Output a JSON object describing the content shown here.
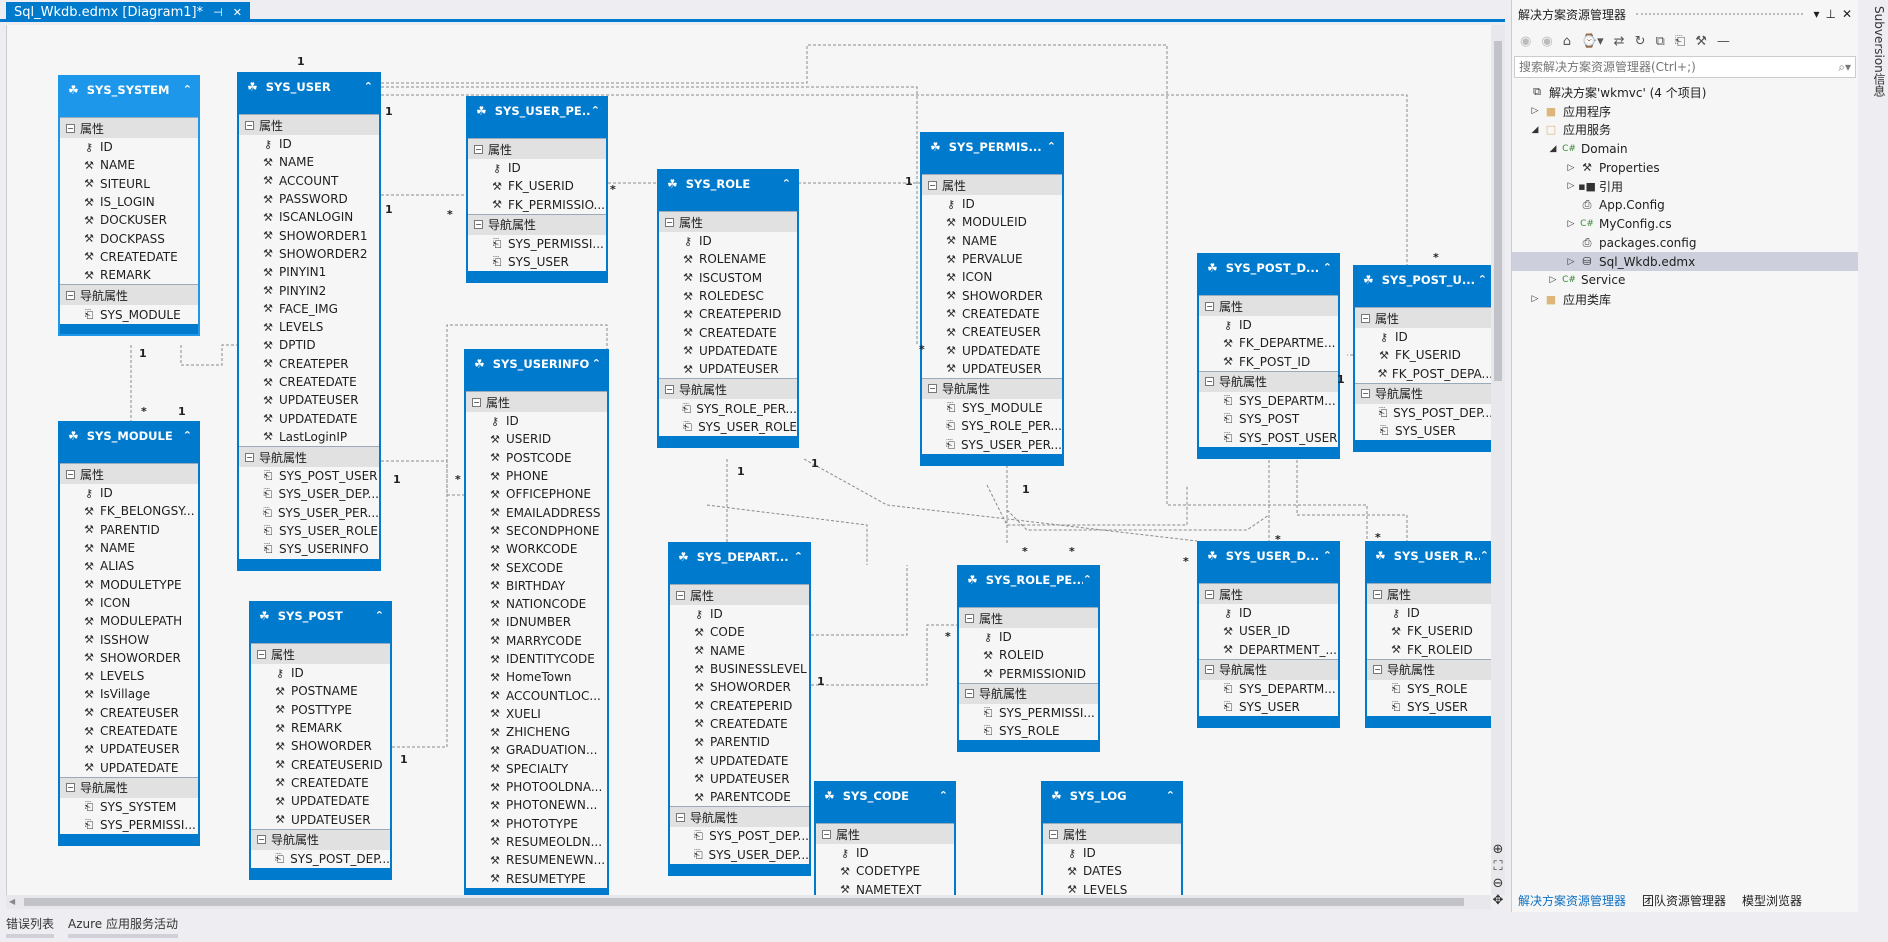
{
  "document_tab": {
    "title": "Sql_Wkdb.edmx [Diagram1]*",
    "pin_icon": "pin-icon",
    "close_icon": "close-icon"
  },
  "colors": {
    "entity_header": "#007acc",
    "entity_header_selected": "#1c97ea",
    "group_bg": "#e1e1e1",
    "accent": "#007acc"
  },
  "diagram": {
    "group_properties": "属性",
    "group_navigation": "导航属性",
    "multiplicity": {
      "one": "1",
      "many": "*"
    },
    "entities": [
      {
        "name": "SYS_SYSTEM",
        "selected": true,
        "properties": [
          "ID",
          "NAME",
          "SITEURL",
          "IS_LOGIN",
          "DOCKUSER",
          "DOCKPASS",
          "CREATEDATE",
          "REMARK"
        ],
        "navigation": [
          "SYS_MODULE"
        ]
      },
      {
        "name": "SYS_USER",
        "properties": [
          "ID",
          "NAME",
          "ACCOUNT",
          "PASSWORD",
          "ISCANLOGIN",
          "SHOWORDER1",
          "SHOWORDER2",
          "PINYIN1",
          "PINYIN2",
          "FACE_IMG",
          "LEVELS",
          "DPTID",
          "CREATEPER",
          "CREATEDATE",
          "UPDATEUSER",
          "UPDATEDATE",
          "LastLoginIP"
        ],
        "navigation": [
          "SYS_POST_USER",
          "SYS_USER_DEP...",
          "SYS_USER_PER...",
          "SYS_USER_ROLE",
          "SYS_USERINFO"
        ]
      },
      {
        "name": "SYS_USER_PE...",
        "properties": [
          "ID",
          "FK_USERID",
          "FK_PERMISSIO..."
        ],
        "navigation": [
          "SYS_PERMISSI...",
          "SYS_USER"
        ]
      },
      {
        "name": "SYS_ROLE",
        "properties": [
          "ID",
          "ROLENAME",
          "ISCUSTOM",
          "ROLEDESC",
          "CREATEPERID",
          "CREATEDATE",
          "UPDATEDATE",
          "UPDATEUSER"
        ],
        "navigation": [
          "SYS_ROLE_PER...",
          "SYS_USER_ROLE"
        ]
      },
      {
        "name": "SYS_PERMIS...",
        "properties": [
          "ID",
          "MODULEID",
          "NAME",
          "PERVALUE",
          "ICON",
          "SHOWORDER",
          "CREATEDATE",
          "CREATEUSER",
          "UPDATEDATE",
          "UPDATEUSER"
        ],
        "navigation": [
          "SYS_MODULE",
          "SYS_ROLE_PER...",
          "SYS_USER_PER..."
        ]
      },
      {
        "name": "SYS_USERINFO",
        "properties": [
          "ID",
          "USERID",
          "POSTCODE",
          "PHONE",
          "OFFICEPHONE",
          "EMAILADDRESS",
          "SECONDPHONE",
          "WORKCODE",
          "SEXCODE",
          "BIRTHDAY",
          "NATIONCODE",
          "IDNUMBER",
          "MARRYCODE",
          "IDENTITYCODE",
          "HomeTown",
          "ACCOUNTLOC...",
          "XUELI",
          "ZHICHENG",
          "GRADUATION...",
          "SPECIALTY",
          "PHOTOOLDNA...",
          "PHOTONEWN...",
          "PHOTOTYPE",
          "RESUMEOLDN...",
          "RESUMENEWN...",
          "RESUMETYPE"
        ],
        "navigation": []
      },
      {
        "name": "SYS_MODULE",
        "properties": [
          "ID",
          "FK_BELONGSY...",
          "PARENTID",
          "NAME",
          "ALIAS",
          "MODULETYPE",
          "ICON",
          "MODULEPATH",
          "ISSHOW",
          "SHOWORDER",
          "LEVELS",
          "IsVillage",
          "CREATEUSER",
          "CREATEDATE",
          "UPDATEUSER",
          "UPDATEDATE"
        ],
        "navigation": [
          "SYS_SYSTEM",
          "SYS_PERMISSI..."
        ]
      },
      {
        "name": "SYS_POST",
        "properties": [
          "ID",
          "POSTNAME",
          "POSTTYPE",
          "REMARK",
          "SHOWORDER",
          "CREATEUSERID",
          "CREATEDATE",
          "UPDATEDATE",
          "UPDATEUSER"
        ],
        "navigation": [
          "SYS_POST_DEP..."
        ]
      },
      {
        "name": "SYS_DEPART...",
        "properties": [
          "ID",
          "CODE",
          "NAME",
          "BUSINESSLEVEL",
          "SHOWORDER",
          "CREATEPERID",
          "CREATEDATE",
          "PARENTID",
          "UPDATEDATE",
          "UPDATEUSER",
          "PARENTCODE"
        ],
        "navigation": [
          "SYS_POST_DEP...",
          "SYS_USER_DEP..."
        ]
      },
      {
        "name": "SYS_ROLE_PE...",
        "properties": [
          "ID",
          "ROLEID",
          "PERMISSIONID"
        ],
        "navigation": [
          "SYS_PERMISSI...",
          "SYS_ROLE"
        ]
      },
      {
        "name": "SYS_CODE",
        "properties": [
          "ID",
          "CODETYPE",
          "NAMETEXT"
        ],
        "navigation": []
      },
      {
        "name": "SYS_LOG",
        "properties": [
          "ID",
          "DATES",
          "LEVELS"
        ],
        "navigation": []
      },
      {
        "name": "SYS_POST_D...",
        "properties": [
          "ID",
          "FK_DEPARTME...",
          "FK_POST_ID"
        ],
        "navigation": [
          "SYS_DEPARTM...",
          "SYS_POST",
          "SYS_POST_USER"
        ]
      },
      {
        "name": "SYS_POST_U...",
        "properties": [
          "ID",
          "FK_USERID",
          "FK_POST_DEPA..."
        ],
        "navigation": [
          "SYS_POST_DEP...",
          "SYS_USER"
        ]
      },
      {
        "name": "SYS_USER_D...",
        "properties": [
          "ID",
          "USER_ID",
          "DEPARTMENT_..."
        ],
        "navigation": [
          "SYS_DEPARTM...",
          "SYS_USER"
        ]
      },
      {
        "name": "SYS_USER_R...",
        "properties": [
          "ID",
          "FK_USERID",
          "FK_ROLEID"
        ],
        "navigation": [
          "SYS_ROLE",
          "SYS_USER"
        ]
      }
    ]
  },
  "bottom_tabs": [
    "错误列表",
    "Azure 应用服务活动"
  ],
  "solution_explorer": {
    "title": "解决方案资源管理器",
    "search_placeholder": "搜索解决方案资源管理器(Ctrl+;)",
    "tree": [
      {
        "label": "解决方案'wkmvc' (4 个项目)",
        "level": 0,
        "expander": "none",
        "icon": "solution-icon"
      },
      {
        "label": "应用程序",
        "level": 0,
        "expander": "collapsed",
        "icon": "folder-icon"
      },
      {
        "label": "应用服务",
        "level": 0,
        "expander": "expanded",
        "icon": "folder-open-icon"
      },
      {
        "label": "Domain",
        "level": 1,
        "expander": "expanded",
        "icon": "csharp-project-icon"
      },
      {
        "label": "Properties",
        "level": 2,
        "expander": "collapsed",
        "icon": "wrench-icon"
      },
      {
        "label": "引用",
        "level": 2,
        "expander": "collapsed",
        "icon": "references-icon"
      },
      {
        "label": "App.Config",
        "level": 2,
        "expander": "none",
        "icon": "config-file-icon"
      },
      {
        "label": "MyConfig.cs",
        "level": 2,
        "expander": "collapsed",
        "icon": "csharp-file-icon"
      },
      {
        "label": "packages.config",
        "level": 2,
        "expander": "none",
        "icon": "config-file-icon"
      },
      {
        "label": "Sql_Wkdb.edmx",
        "level": 2,
        "expander": "collapsed",
        "icon": "edmx-icon",
        "selected": true
      },
      {
        "label": "Service",
        "level": 1,
        "expander": "collapsed",
        "icon": "csharp-project-icon"
      },
      {
        "label": "应用类库",
        "level": 0,
        "expander": "collapsed",
        "icon": "folder-icon"
      }
    ],
    "tabs": [
      {
        "label": "解决方案资源管理器",
        "active": true
      },
      {
        "label": "团队资源管理器"
      },
      {
        "label": "模型浏览器"
      }
    ]
  },
  "side_strip": {
    "label": "Subversion信息"
  }
}
